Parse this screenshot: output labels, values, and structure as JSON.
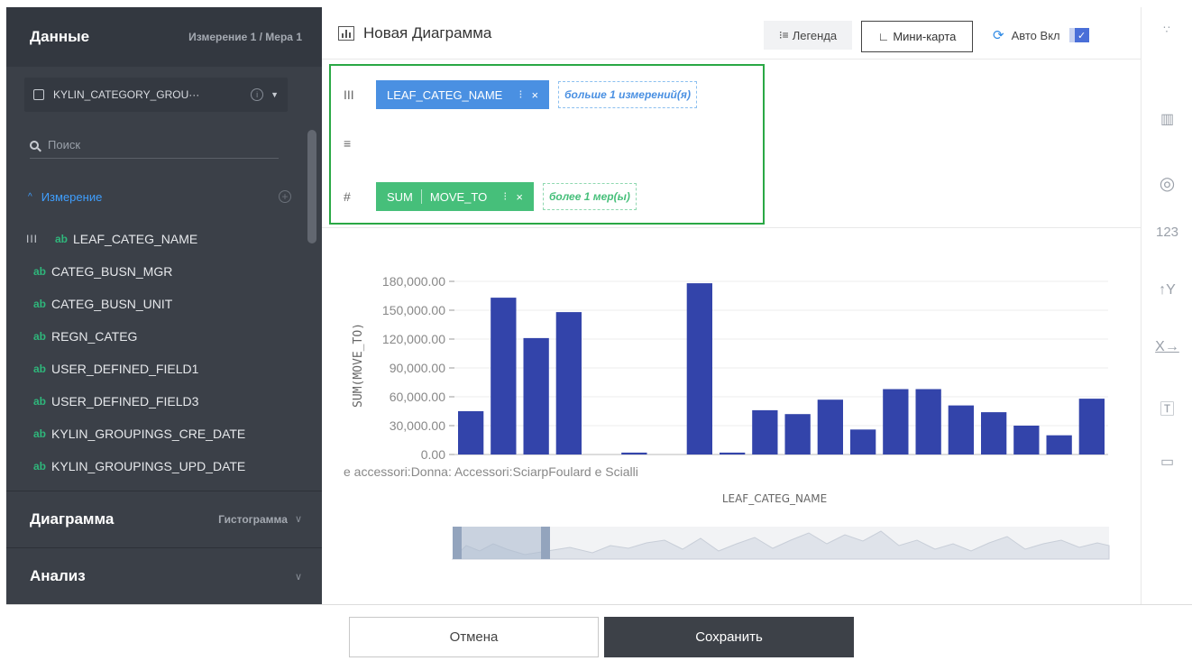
{
  "sidebar": {
    "data_title": "Данные",
    "data_subtitle": "Измерение 1 / Мера 1",
    "dataset_name": "KYLIN_CATEGORY_GROU···",
    "search_placeholder": "Поиск",
    "dimension_group": "Измерение",
    "fields": [
      "LEAF_CATEG_NAME",
      "CATEG_BUSN_MGR",
      "CATEG_BUSN_UNIT",
      "REGN_CATEG",
      "USER_DEFINED_FIELD1",
      "USER_DEFINED_FIELD3",
      "KYLIN_GROUPINGS_CRE_DATE",
      "KYLIN_GROUPINGS_UPD_DATE"
    ],
    "field_type_label": "ab",
    "chart_title": "Диаграмма",
    "chart_subtitle": "Гистограмма",
    "analysis_title": "Анализ"
  },
  "topbar": {
    "title": "Новая Диаграмма",
    "legend_label": "Легенда",
    "minimap_label": "Мини-карта",
    "auto_label": "Авто Вкл"
  },
  "shelves": {
    "column_pill": "LEAF_CATEG_NAME",
    "column_hint": "больше 1 измерений(я)",
    "measure_agg": "SUM",
    "measure_field": "MOVE_TO",
    "measure_hint": "более 1 мер(ы)"
  },
  "right_toolbar": {
    "number_label": "123"
  },
  "footer": {
    "cancel_label": "Отмена",
    "save_label": "Сохранить"
  },
  "colors": {
    "bar": "#3344aa",
    "accent_blue": "#4a90e2",
    "accent_green": "#46bf7a",
    "sidebar_bg": "#3b4048",
    "frame_green": "#2aa845"
  },
  "chart_data": {
    "type": "bar",
    "ylabel": "SUM(MOVE_TO)",
    "xlabel": "LEAF_CATEG_NAME",
    "x_tick_label": "e accessori:Donna: Accessori:SciarpFoulard e Scialli",
    "y_ticks": [
      "180,000.00",
      "150,000.00",
      "120,000.00",
      "90,000.00",
      "60,000.00",
      "30,000.00",
      "0.00"
    ],
    "ylim": [
      0,
      180000
    ],
    "values": [
      45000,
      163000,
      121000,
      148000,
      0,
      2000,
      0,
      178000,
      2000,
      46000,
      42000,
      57000,
      26000,
      68000,
      68000,
      51000,
      44000,
      30000,
      20000,
      58000
    ],
    "grid": true,
    "minimap": true
  }
}
